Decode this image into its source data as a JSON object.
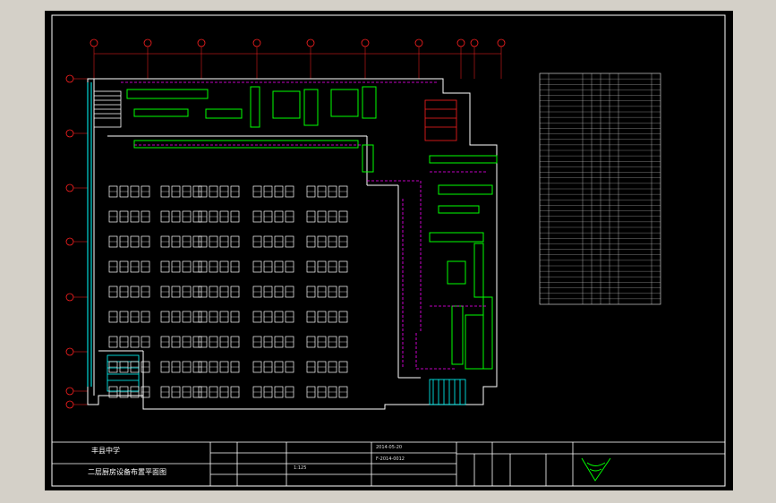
{
  "app": {
    "background": "#d4d0c8",
    "canvas_color": "#000000"
  },
  "title_block": {
    "project": "丰县中学",
    "drawing_title": "二层厨房设备布置平面图",
    "scale": "1:125",
    "date": "2014-05-20",
    "drawing_no": "F-2014-0012"
  },
  "colors": {
    "wall": "#ffffff",
    "equipment": "#00ff00",
    "pipe": "#ff00ff",
    "axis": "#ff2020",
    "table_line": "#cfcfcf",
    "window": "#00ffff"
  },
  "axes": {
    "columns": [
      "1",
      "2",
      "3",
      "4",
      "5",
      "6",
      "7",
      "8",
      "9",
      "10"
    ],
    "rows": [
      "A",
      "B",
      "C",
      "D",
      "E",
      "F",
      "G",
      "H"
    ]
  },
  "legend": {
    "rows": 42,
    "columns": 8
  }
}
